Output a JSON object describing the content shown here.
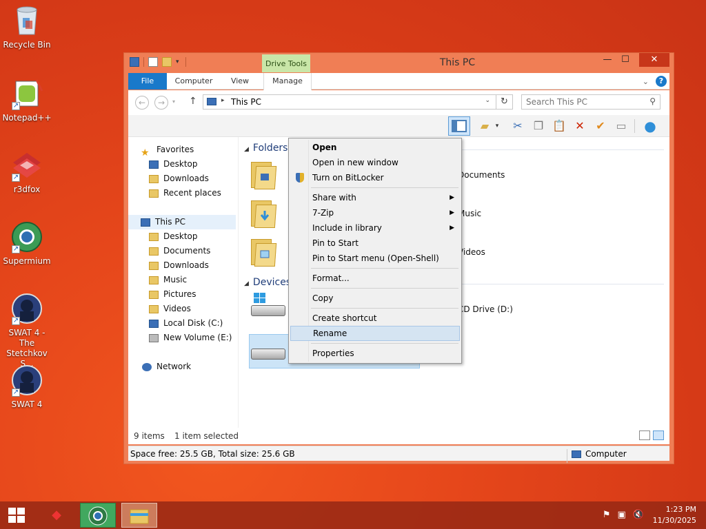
{
  "desktop": {
    "icons": [
      {
        "label": "Recycle Bin"
      },
      {
        "label": "Notepad++"
      },
      {
        "label": "r3dfox"
      },
      {
        "label": "Supermium"
      },
      {
        "label": "SWAT 4 - The Stetchkov S..."
      },
      {
        "label": "SWAT 4"
      }
    ]
  },
  "window": {
    "title": "This PC",
    "contextual_tab": "Drive Tools",
    "tabs": {
      "file": "File",
      "computer": "Computer",
      "view": "View",
      "manage": "Manage"
    },
    "address": "This PC",
    "search_placeholder": "Search This PC",
    "nav": {
      "favorites": "Favorites",
      "fav_items": [
        "Desktop",
        "Downloads",
        "Recent places"
      ],
      "this_pc": "This PC",
      "pc_items": [
        "Desktop",
        "Documents",
        "Downloads",
        "Music",
        "Pictures",
        "Videos",
        "Local Disk (C:)",
        "New Volume (E:)"
      ],
      "network": "Network"
    },
    "groups": {
      "folders": "Folders",
      "devices": "Devices"
    },
    "folders_right": [
      "Documents",
      "Music",
      "Videos"
    ],
    "devices_right": "CD Drive (D:)",
    "status": {
      "items": "9 items",
      "selected": "1 item selected"
    },
    "details": {
      "space": "Space free: 25.5 GB, Total size: 25.6 GB",
      "computer": "Computer"
    }
  },
  "context_menu": {
    "items": [
      "Open",
      "Open in new window",
      "Turn on BitLocker",
      "Share with",
      "7-Zip",
      "Include in library",
      "Pin to Start",
      "Pin to Start menu (Open-Shell)",
      "Format...",
      "Copy",
      "Create shortcut",
      "Rename",
      "Properties"
    ]
  },
  "taskbar": {
    "time": "1:23 PM",
    "date": "11/30/2025"
  },
  "colors": {
    "accent": "#1979ca",
    "drive_tools": "#c9e6a8",
    "desktop": "#e6471b"
  }
}
